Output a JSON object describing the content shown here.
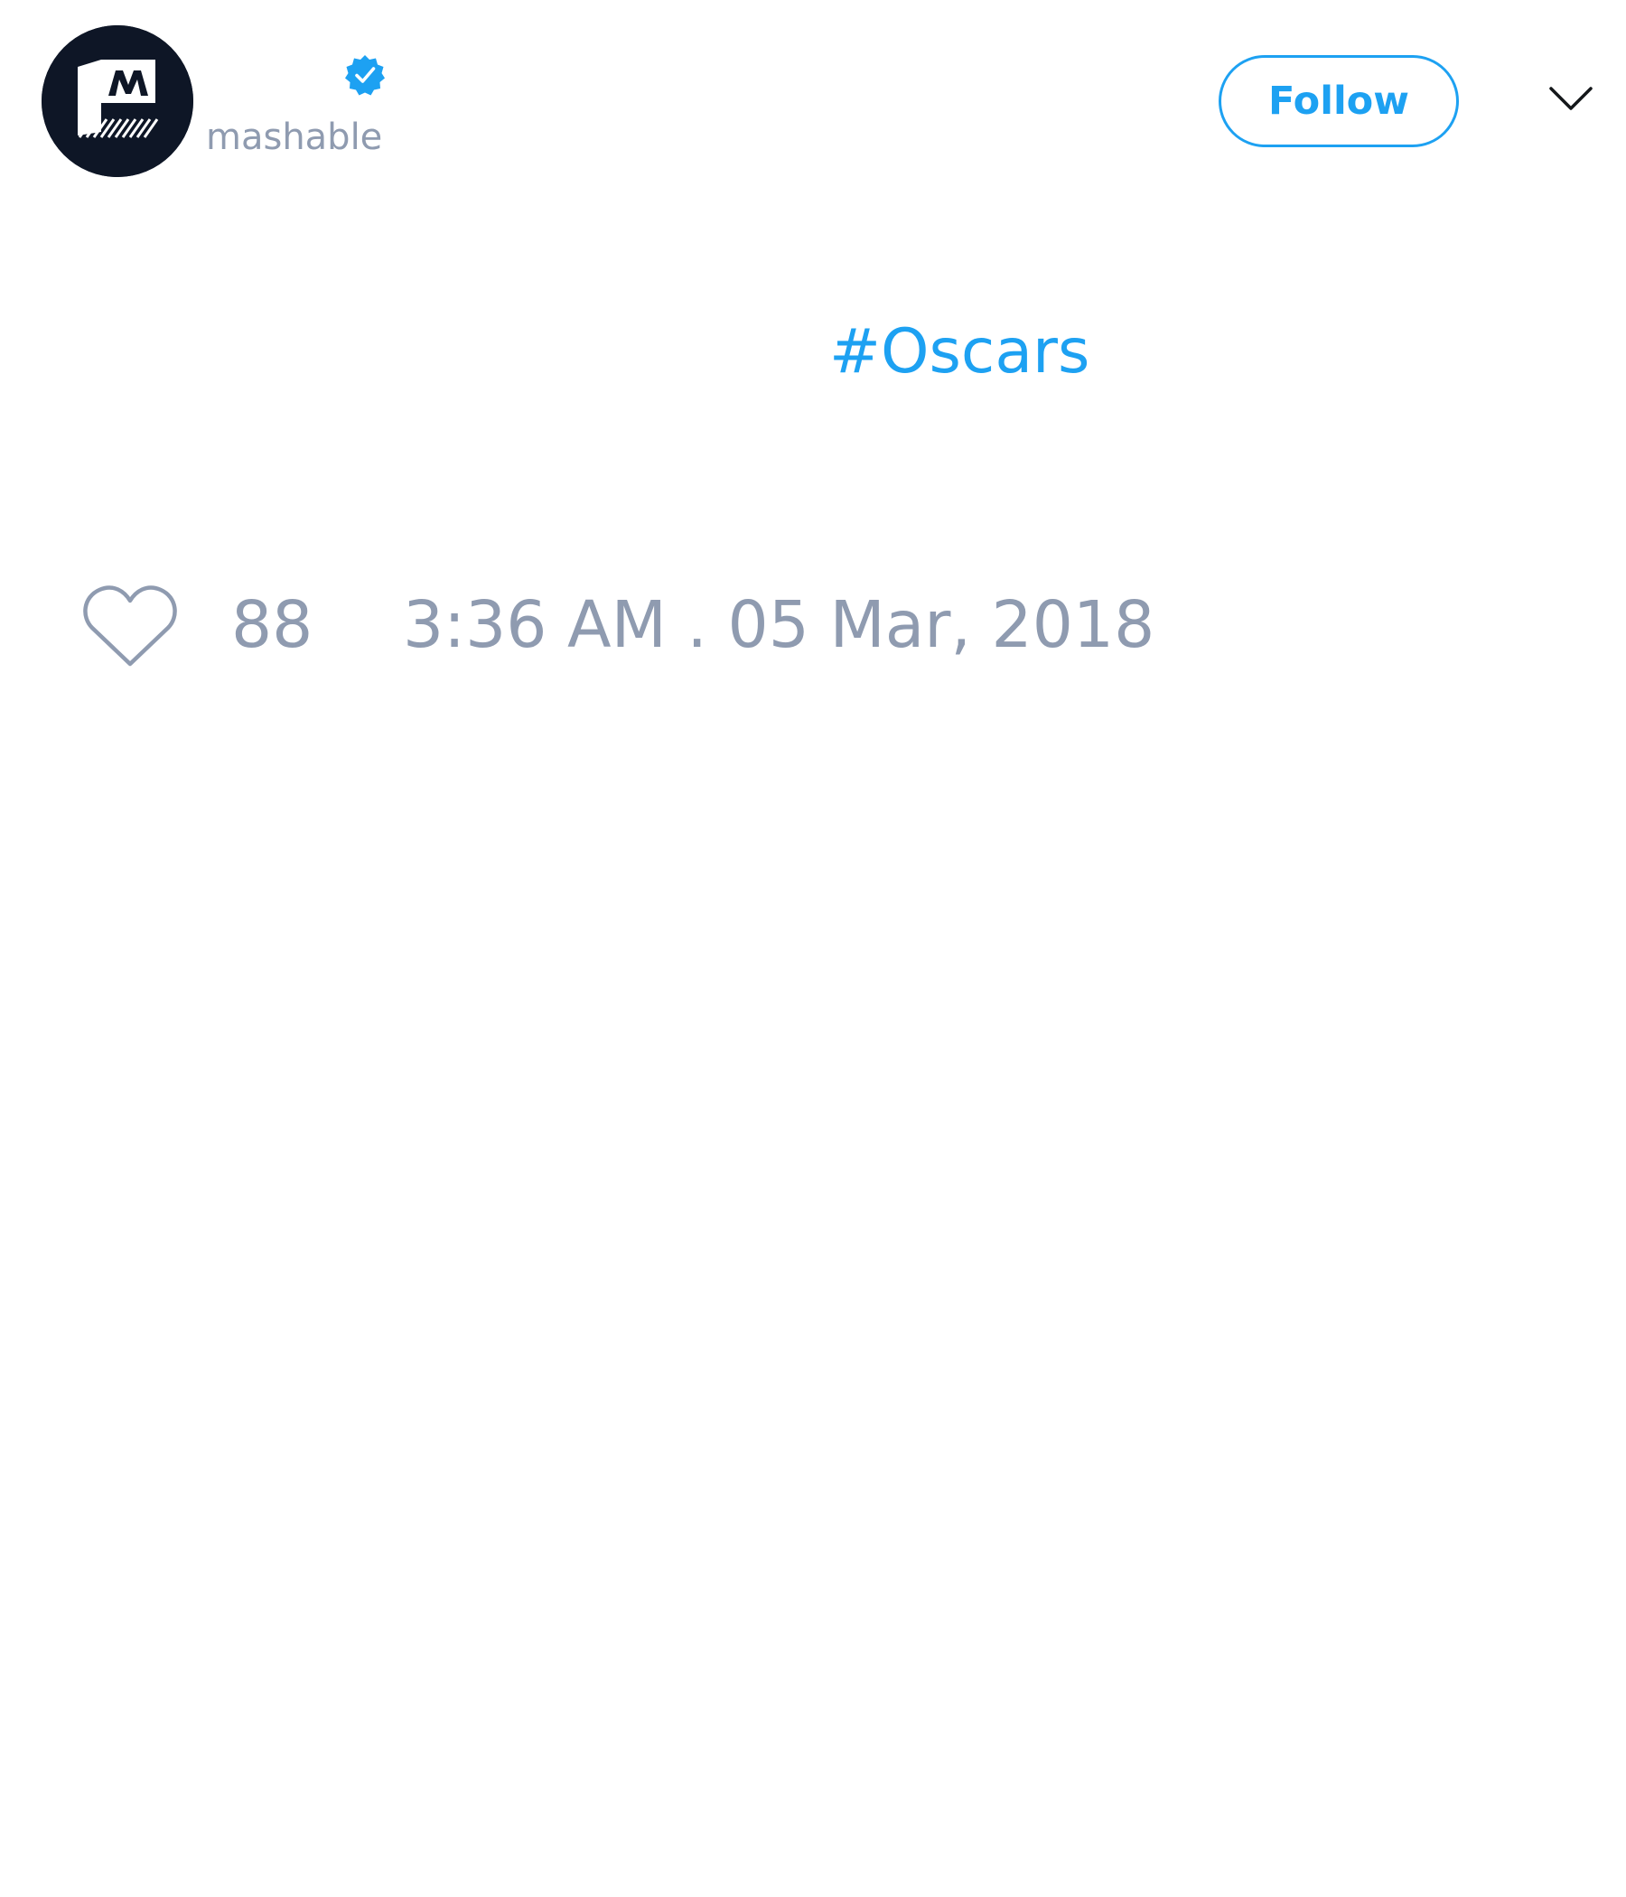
{
  "header": {
    "handle": "mashable",
    "verified_icon": "verified-badge-icon",
    "follow_label": "Follow",
    "menu_icon": "chevron-down-icon"
  },
  "tweet": {
    "hashtag": "#Oscars"
  },
  "footer": {
    "like_icon": "heart-icon",
    "like_count": "88",
    "timestamp": "3:36 AM . 05 Mar, 2018"
  },
  "colors": {
    "accent": "#1da1f2",
    "muted_text": "#8f9bb0",
    "avatar_bg": "#0e1626"
  }
}
